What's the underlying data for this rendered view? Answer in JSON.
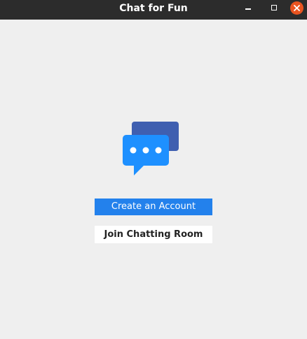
{
  "window": {
    "title": "Chat for Fun"
  },
  "logo": {
    "icon": "chat-bubbles-icon",
    "front_color": "#1e90ff",
    "back_color": "#3f5fb0"
  },
  "actions": {
    "create_account_label": "Create an Account",
    "join_room_label": "Join Chatting Room"
  },
  "colors": {
    "titlebar": "#2c2c2c",
    "close_button": "#e95420",
    "primary_button": "#2381ec",
    "background": "#efefef"
  }
}
